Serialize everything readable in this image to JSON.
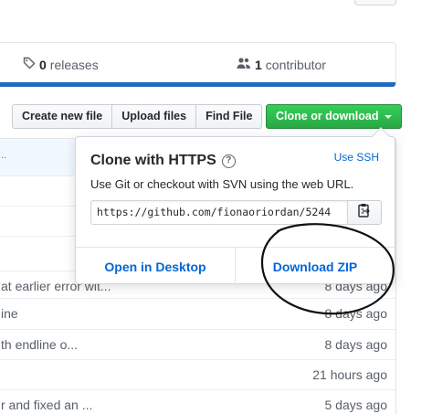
{
  "summary": {
    "releases_count": "0",
    "releases_label": "releases",
    "contributors_count": "1",
    "contributors_label": "contributor"
  },
  "toolbar": {
    "create_new_file": "Create new file",
    "upload_files": "Upload files",
    "find_file": "Find File",
    "clone_or_download": "Clone or download"
  },
  "clone_popover": {
    "title": "Clone with HTTPS",
    "use_ssh": "Use SSH",
    "description": "Use Git or checkout with SVN using the web URL.",
    "url": "https://github.com/fionaoriordan/5244",
    "open_in_desktop": "Open in Desktop",
    "download_zip": "Download ZIP"
  },
  "file_rows": [
    {
      "message": "..",
      "age": ""
    },
    {
      "message": "",
      "age": ""
    },
    {
      "message": "",
      "age": ""
    },
    {
      "message": "",
      "age": ""
    },
    {
      "message": "at earlier error wit...",
      "age": "8 days ago"
    },
    {
      "message": "ine",
      "age": "8 days ago"
    },
    {
      "message": "th endline o...",
      "age": "8 days ago"
    },
    {
      "message": "",
      "age": "21 hours ago"
    },
    {
      "message": "r and fixed an ...",
      "age": "5 days ago"
    }
  ],
  "colors": {
    "accent_blue": "#0366d6",
    "green_button": "#28a745",
    "annotation": "#111111"
  }
}
